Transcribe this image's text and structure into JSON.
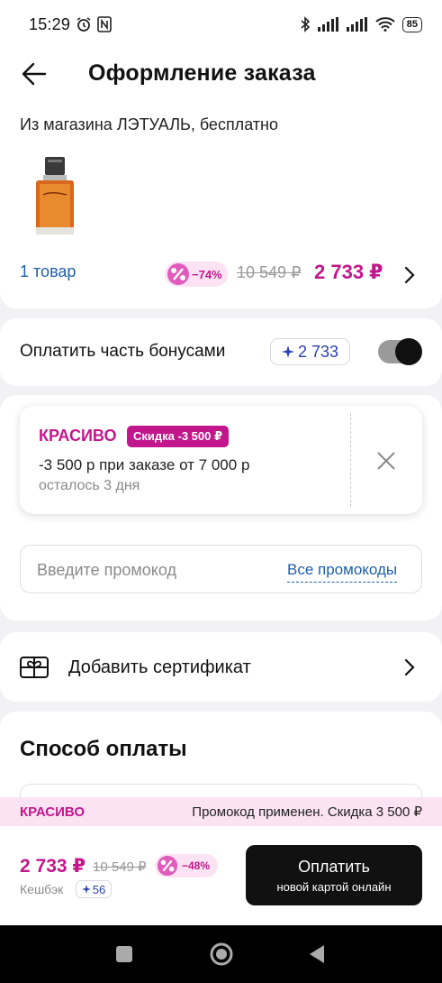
{
  "status_bar": {
    "time": "15:29",
    "battery": "85"
  },
  "header": {
    "title": "Оформление заказа"
  },
  "order": {
    "store": "Из магазина ЛЭТУАЛЬ, бесплатно",
    "items_count": "1 товар",
    "discount": "−74%",
    "old_price": "10 549 ₽",
    "new_price": "2 733 ₽"
  },
  "bonus": {
    "label": "Оплатить часть бонусами",
    "amount": "2 733",
    "enabled": true
  },
  "promo": {
    "code": "КРАСИВО",
    "badge": "Скидка -3 500 ₽",
    "description": "-3 500 р при заказе от 7 000 р",
    "remaining": "осталось 3 дня",
    "input_placeholder": "Введите промокод",
    "all_promos": "Все промокоды"
  },
  "certificate": {
    "label": "Добавить сертификат"
  },
  "payment": {
    "title": "Способ оплаты"
  },
  "banner": {
    "code": "КРАСИВО",
    "message": "Промокод применен. Скидка 3 500 ₽"
  },
  "summary": {
    "price": "2 733 ₽",
    "old_price": "10 549 ₽",
    "discount": "−48%",
    "cashback_label": "Кешбэк",
    "cashback_value": "56",
    "pay_button": "Оплатить",
    "pay_button_sub": "новой картой онлайн"
  },
  "colors": {
    "accent": "#c2178c",
    "link": "#1f5fa8",
    "bonus": "#2a3fb0"
  }
}
